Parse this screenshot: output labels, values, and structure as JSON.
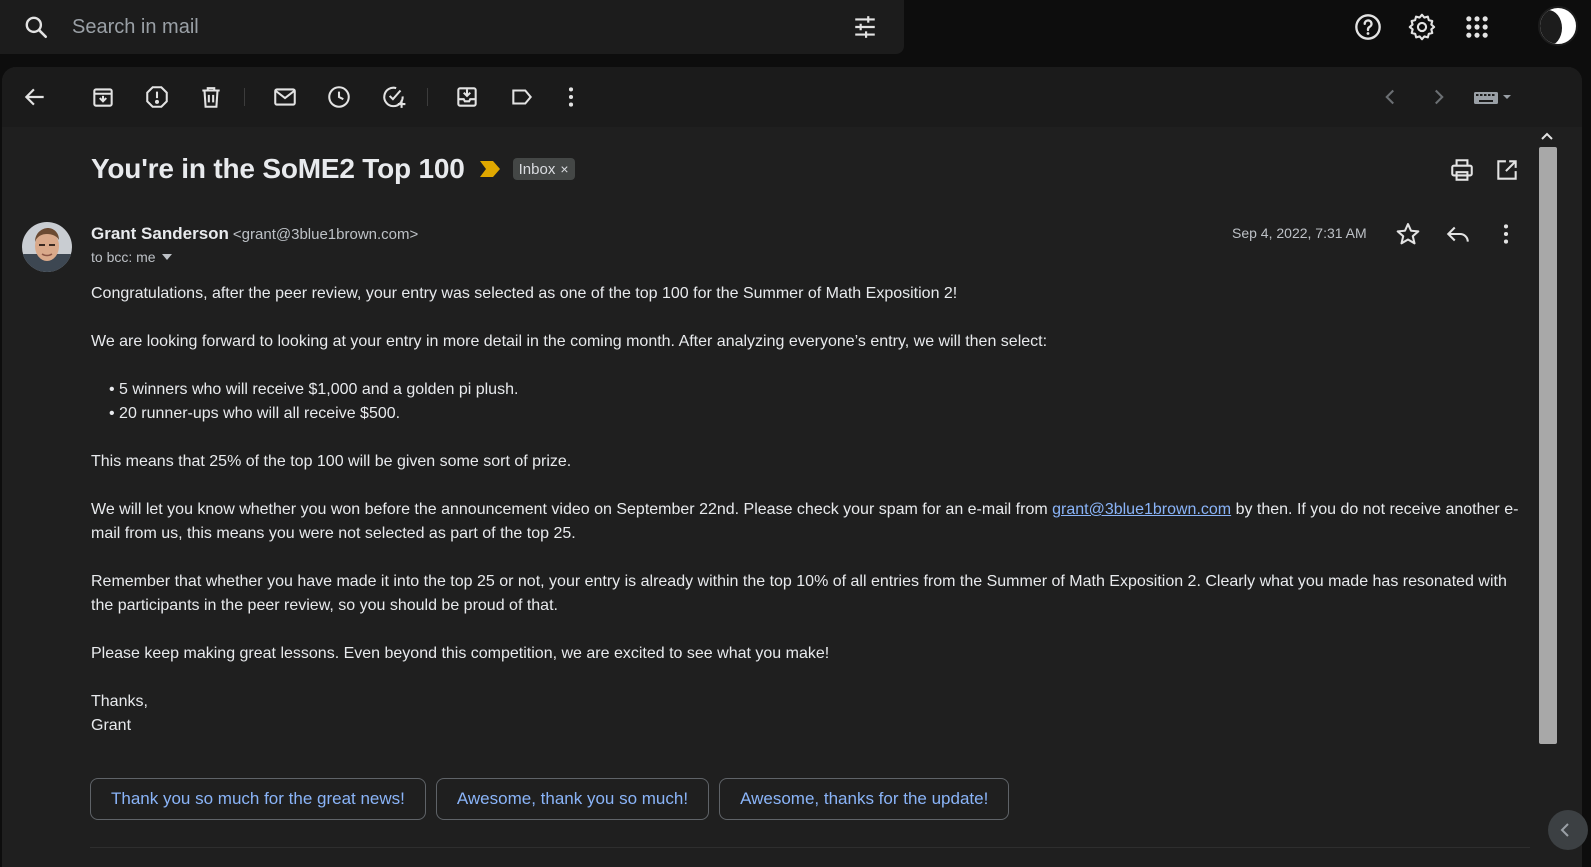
{
  "search": {
    "placeholder": "Search in mail"
  },
  "email": {
    "subject": "You're in the SoME2 Top 100",
    "label_chip": "Inbox",
    "label_remove": "×",
    "sender_name": "Grant Sanderson",
    "sender_email": "<grant@3blue1brown.com>",
    "recipients": "to bcc: me",
    "date": "Sep 4, 2022, 7:31 AM",
    "body": {
      "p1": "Congratulations, after the peer review, your entry was selected as one of the top 100 for the Summer of Math Exposition 2!",
      "p2": "We are looking forward to looking at your entry in more detail in the coming month. After analyzing everyone’s entry, we will then select:",
      "bullets": [
        "5 winners who will receive $1,000 and a golden pi plush.",
        "20 runner-ups who will all receive $500."
      ],
      "p3": "This means that 25% of the top 100 will be given some sort of prize.",
      "p4_before": "We will let you know whether you won before the announcement video on September 22nd. Please check your spam for an e-mail from ",
      "p4_link": "grant@3blue1brown.com",
      "p4_after": " by then. If you do not receive another e-mail from us, this means you were not selected as part of the top 25.",
      "p5": "Remember that whether you have made it into the top 25 or not, your entry is already within the top 10% of all entries from the Summer of Math Exposition 2. Clearly what you made has resonated with the participants in the peer review, so you should be proud of that.",
      "p6": "Please keep making great lessons. Even beyond this competition, we are excited to see what you make!",
      "signoff": "Thanks,",
      "signature": "Grant"
    }
  },
  "smart_replies": [
    "Thank you so much for the great news!",
    "Awesome, thank you so much!",
    "Awesome, thanks for the update!"
  ],
  "colors": {
    "background": "#0d0d0d",
    "card": "#1f1f1f",
    "link": "#8ab4f8",
    "importance_marker": "#e0a800"
  },
  "icons": {
    "top": [
      "search-icon",
      "filter-icon",
      "help-icon",
      "settings-icon",
      "apps-grid-icon",
      "account-avatar"
    ],
    "toolbar": [
      "back-arrow-icon",
      "archive-icon",
      "report-spam-icon",
      "delete-icon",
      "mark-unread-icon",
      "snooze-icon",
      "add-task-icon",
      "move-to-icon",
      "label-icon",
      "more-vert-icon",
      "newer-chevron-icon",
      "older-chevron-icon",
      "input-tools-icon"
    ],
    "header": [
      "print-icon",
      "open-new-window-icon",
      "star-icon",
      "reply-icon",
      "more-vert-icon"
    ]
  }
}
